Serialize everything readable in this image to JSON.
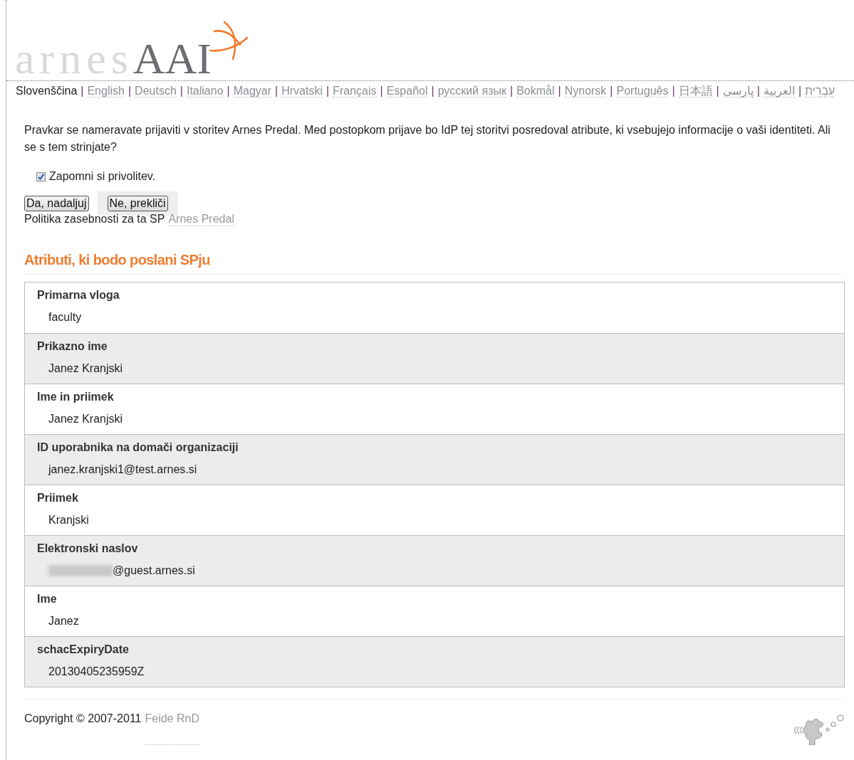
{
  "logo": {
    "light": "arnes",
    "dark": "AAI"
  },
  "languages": [
    {
      "label": "Slovenščina",
      "selected": true
    },
    {
      "label": "English",
      "selected": false
    },
    {
      "label": "Deutsch",
      "selected": false
    },
    {
      "label": "Italiano",
      "selected": false
    },
    {
      "label": "Magyar",
      "selected": false
    },
    {
      "label": "Hrvatski",
      "selected": false
    },
    {
      "label": "Français",
      "selected": false
    },
    {
      "label": "Español",
      "selected": false
    },
    {
      "label": "русский язык",
      "selected": false
    },
    {
      "label": "Bokmål",
      "selected": false
    },
    {
      "label": "Nynorsk",
      "selected": false
    },
    {
      "label": "Português",
      "selected": false
    },
    {
      "label": "日本語",
      "selected": false
    },
    {
      "label": "پارسی",
      "selected": false
    },
    {
      "label": "العربية",
      "selected": false
    },
    {
      "label": "עִבְרִית",
      "selected": false
    }
  ],
  "separator": "|",
  "intro": "Pravkar se nameravate prijaviti v storitev Arnes Predal. Med postopkom prijave bo IdP tej storitvi posredoval atribute, ki vsebujejo informacije o vaši identiteti. Ali se s tem strinjate?",
  "remember": {
    "label": "Zapomni si privolitev.",
    "checked": true
  },
  "buttons": [
    "Da, nadaljuj",
    "Ne, prekliči"
  ],
  "privacy": {
    "text": "Politika zasebnosti za ta SP",
    "link": "Arnes Predal"
  },
  "attributes_title": "Atributi, ki bodo poslani SPju",
  "attributes": [
    {
      "name": "Primarna vloga",
      "value": "faculty",
      "redacted": false
    },
    {
      "name": "Prikazno ime",
      "value": "Janez Kranjski",
      "redacted": false
    },
    {
      "name": "Ime in priimek",
      "value": "Janez Kranjski",
      "redacted": false
    },
    {
      "name": "ID uporabnika na domači organizaciji",
      "value": "janez.kranjski1@test.arnes.si",
      "redacted": false
    },
    {
      "name": "Priimek",
      "value": "Kranjski",
      "redacted": false
    },
    {
      "name": "Elektronski naslov",
      "value": "@guest.arnes.si",
      "redacted": true
    },
    {
      "name": "Ime",
      "value": "Janez",
      "redacted": false
    },
    {
      "name": "schacExpiryDate",
      "value": "20130405235959Z",
      "redacted": false
    }
  ],
  "footer": {
    "text": "Copyright © 2007-2011",
    "link": "Feide RnD"
  }
}
